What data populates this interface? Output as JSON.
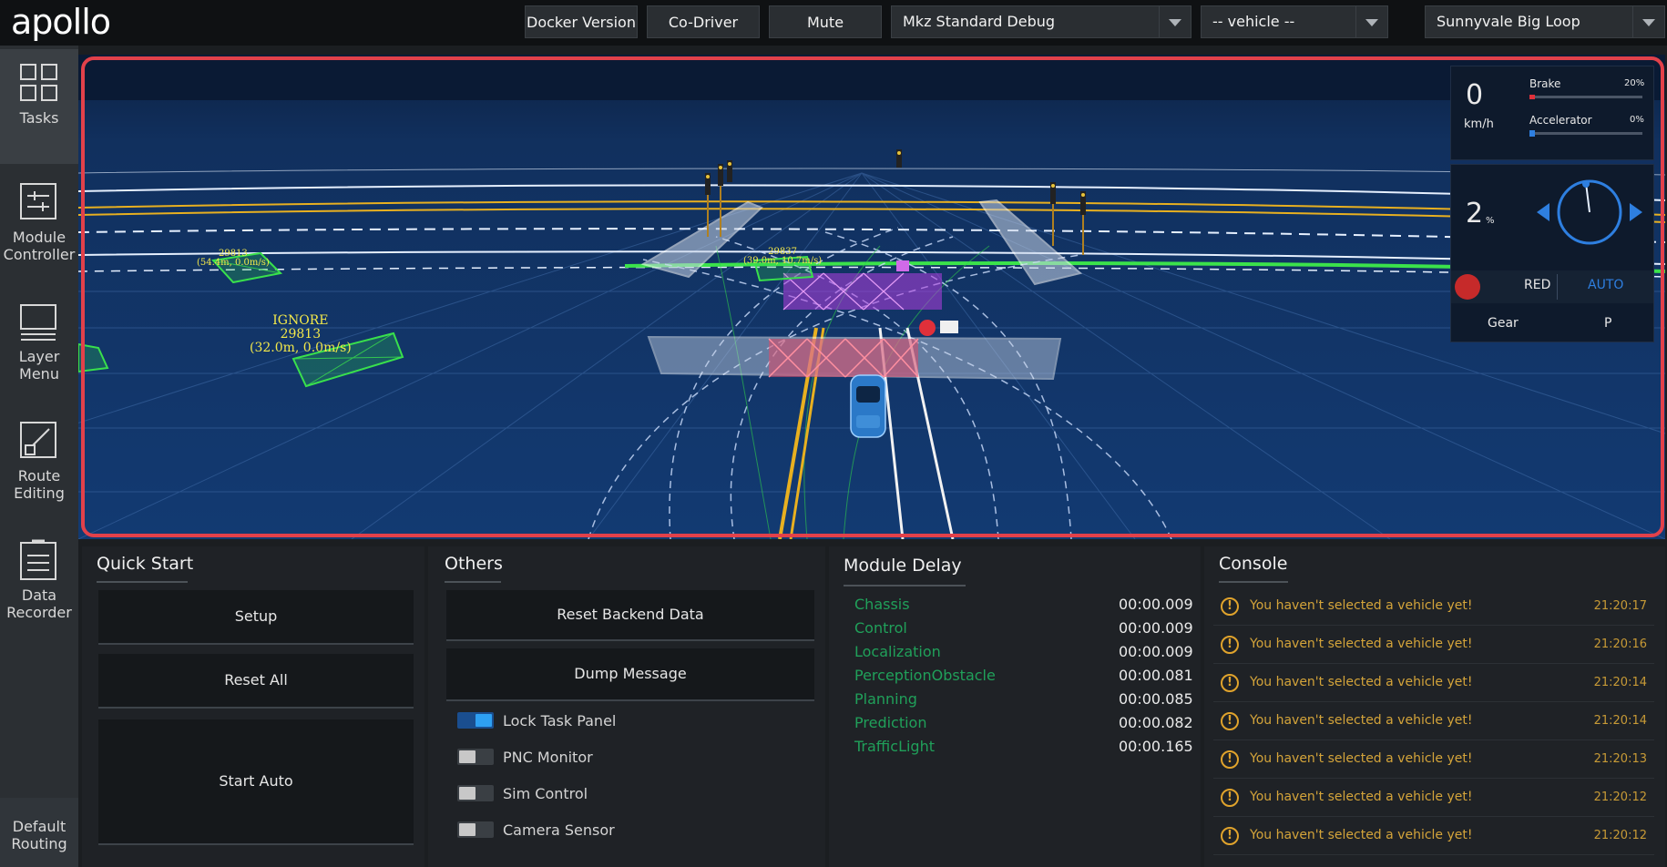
{
  "app": {
    "logo": "apollo"
  },
  "header": {
    "buttons": [
      "Docker Version",
      "Co-Driver",
      "Mute"
    ],
    "mode_select": "Mkz Standard Debug",
    "vehicle_select": "-- vehicle --",
    "map_select": "Sunnyvale Big Loop"
  },
  "sidebar": {
    "items": [
      {
        "label": "Tasks",
        "icon": "grid-icon"
      },
      {
        "label": "Module Controller",
        "icon": "module-controller-icon"
      },
      {
        "label": "Layer Menu",
        "icon": "layer-menu-icon"
      },
      {
        "label": "Route Editing",
        "icon": "route-editing-icon"
      },
      {
        "label": "Data Recorder",
        "icon": "data-recorder-icon"
      },
      {
        "label": "Default Routing",
        "icon": ""
      }
    ]
  },
  "scene": {
    "obstacle_labels": [
      {
        "line1": "29813",
        "line2": "(54.4m, 0.0m/s)"
      },
      {
        "line1": "IGNORE",
        "line2": "29813",
        "line3": "(32.0m, 0.0m/s)"
      },
      {
        "line1": "29837",
        "line2": "(39.0m, 10.7m/s)"
      }
    ],
    "hud": {
      "speed_value": "0",
      "speed_unit": "km/h",
      "brake_label": "Brake",
      "brake_value": "20%",
      "brake_level": 0.2,
      "accel_label": "Accelerator",
      "accel_value": "0%",
      "accel_level": 0.0,
      "steering_value": "2",
      "steering_unit": "%",
      "signal_label": "RED",
      "drive_mode": "AUTO",
      "gear_label": "Gear",
      "gear_value": "P"
    },
    "colors": {
      "ground": "#0f2b56",
      "highlight_border": "#e2414a",
      "lane_yellow": "#e8b020",
      "obstacle_green": "#39e04c",
      "label_yellow": "#f3e84a"
    }
  },
  "quick_start": {
    "title": "Quick Start",
    "buttons": [
      "Setup",
      "Reset All",
      "Start Auto"
    ]
  },
  "others": {
    "title": "Others",
    "buttons": [
      "Reset Backend Data",
      "Dump Message"
    ],
    "toggles": [
      {
        "label": "Lock Task Panel",
        "on": true
      },
      {
        "label": "PNC Monitor",
        "on": false
      },
      {
        "label": "Sim Control",
        "on": false
      },
      {
        "label": "Camera Sensor",
        "on": false
      }
    ]
  },
  "module_delay": {
    "title": "Module Delay",
    "rows": [
      {
        "name": "Chassis",
        "value": "00:00.009"
      },
      {
        "name": "Control",
        "value": "00:00.009"
      },
      {
        "name": "Localization",
        "value": "00:00.009"
      },
      {
        "name": "PerceptionObstacle",
        "value": "00:00.081"
      },
      {
        "name": "Planning",
        "value": "00:00.085"
      },
      {
        "name": "Prediction",
        "value": "00:00.082"
      },
      {
        "name": "TrafficLight",
        "value": "00:00.165"
      }
    ]
  },
  "console": {
    "title": "Console",
    "messages": [
      {
        "text": "You haven't selected a vehicle yet!",
        "time": "21:20:17"
      },
      {
        "text": "You haven't selected a vehicle yet!",
        "time": "21:20:16"
      },
      {
        "text": "You haven't selected a vehicle yet!",
        "time": "21:20:14"
      },
      {
        "text": "You haven't selected a vehicle yet!",
        "time": "21:20:14"
      },
      {
        "text": "You haven't selected a vehicle yet!",
        "time": "21:20:13"
      },
      {
        "text": "You haven't selected a vehicle yet!",
        "time": "21:20:12"
      },
      {
        "text": "You haven't selected a vehicle yet!",
        "time": "21:20:12"
      }
    ]
  }
}
